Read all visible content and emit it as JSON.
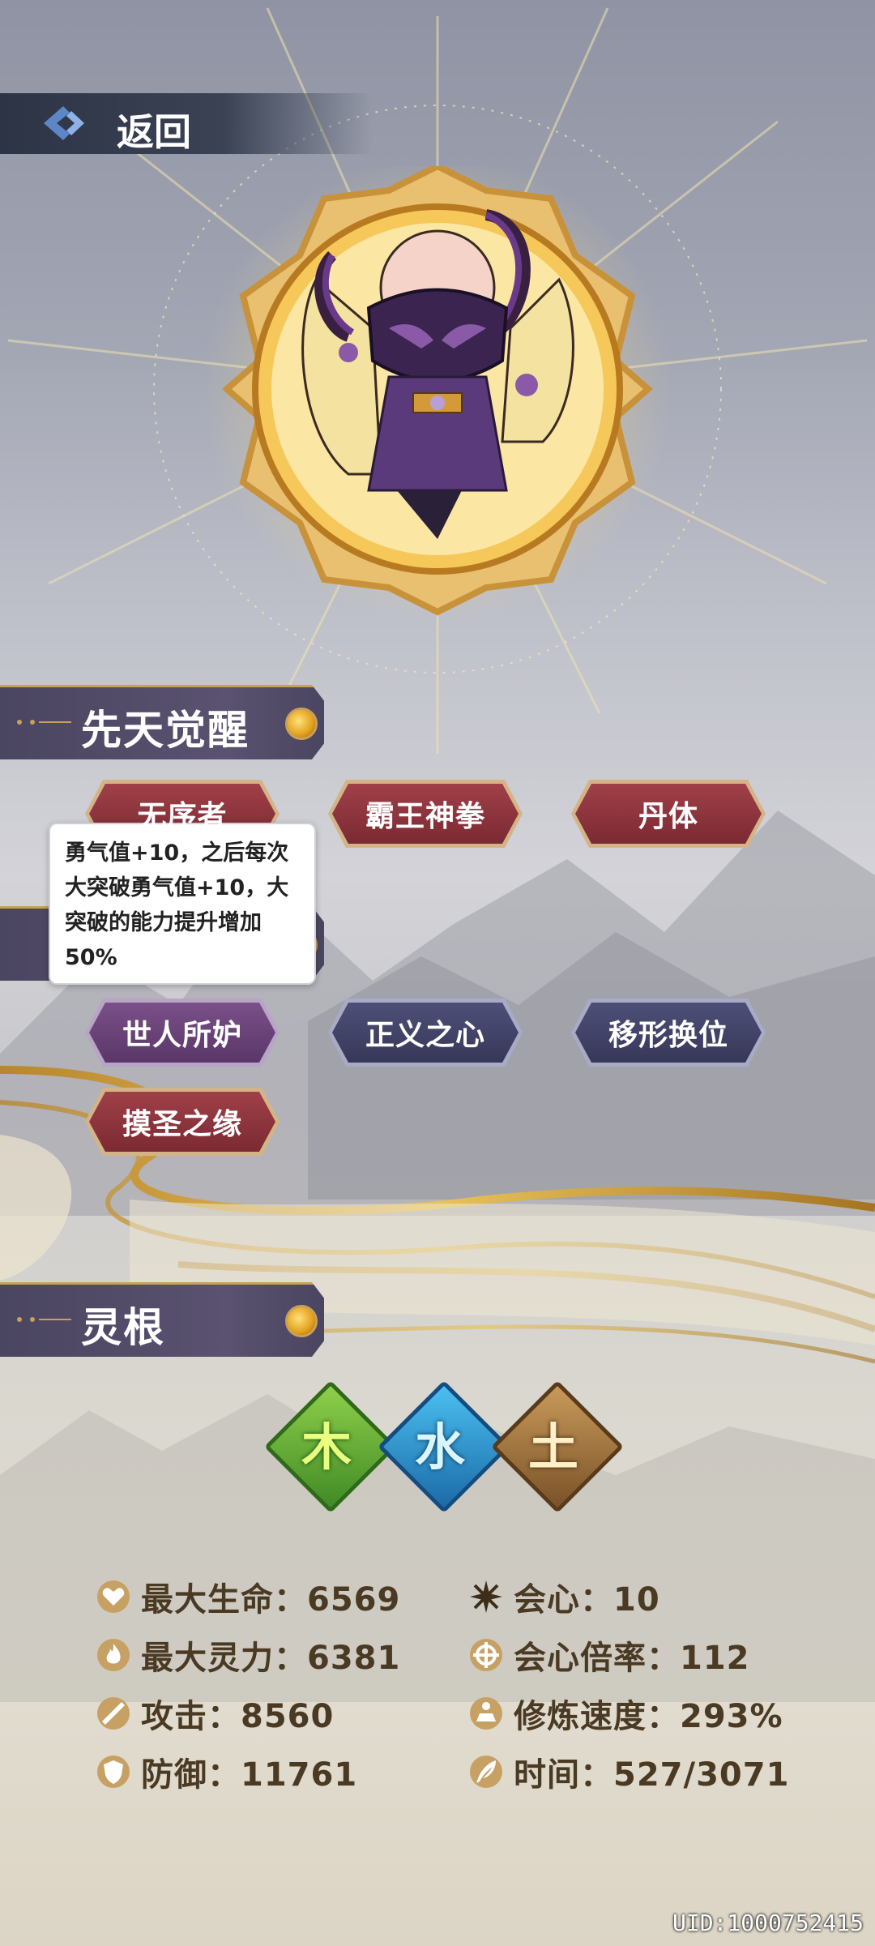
{
  "header": {
    "back_label": "返回"
  },
  "sections": {
    "innate": {
      "title": "先天觉醒"
    },
    "spirit_root": {
      "title": "灵根"
    }
  },
  "innate_tags": [
    {
      "label": "无序者",
      "style": "red"
    },
    {
      "label": "霸王神拳",
      "style": "red"
    },
    {
      "label": "丹体",
      "style": "red"
    }
  ],
  "tooltip": {
    "text": "勇气值+10，之后每次大突破勇气值+10，大突破的能力提升增加50%"
  },
  "trait_tags": [
    {
      "label": "世人所妒",
      "style": "purple"
    },
    {
      "label": "正义之心",
      "style": "navy"
    },
    {
      "label": "移形换位",
      "style": "navy"
    },
    {
      "label": "摸圣之缘",
      "style": "red"
    }
  ],
  "elements": [
    {
      "glyph": "木",
      "icon": "wood-element-icon",
      "color": "#5aa030"
    },
    {
      "glyph": "水",
      "icon": "water-element-icon",
      "color": "#2a8ed0"
    },
    {
      "glyph": "土",
      "icon": "earth-element-icon",
      "color": "#a07840"
    }
  ],
  "stats": {
    "max_hp": "最大生命：6569",
    "crit": "会心：10",
    "max_spirit": "最大灵力：6381",
    "crit_multiplier": "会心倍率：112",
    "attack": "攻击：8560",
    "cultivation_speed": "修炼速度：293%",
    "defense": "防御：11761",
    "time": "时间：527/3071"
  },
  "uid": "UID:1000752415"
}
